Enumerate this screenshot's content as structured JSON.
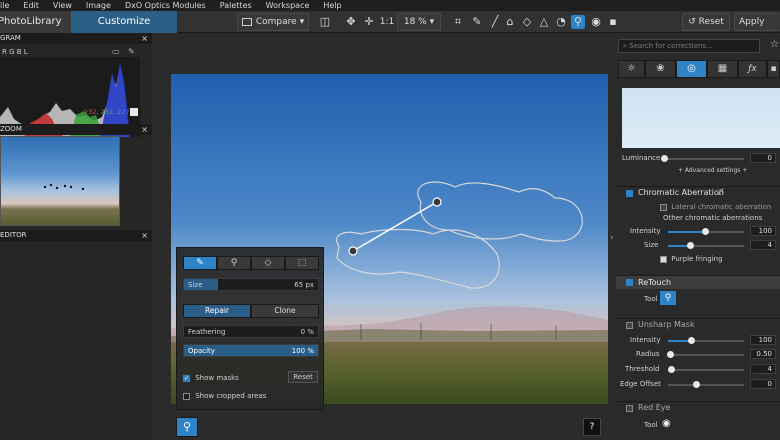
{
  "menu": [
    "File",
    "Edit",
    "View",
    "Image",
    "DxO Optics Modules",
    "Palettes",
    "Workspace",
    "Help"
  ],
  "tabs": {
    "library": "PhotoLibrary",
    "customize": "Customize"
  },
  "toolbar": {
    "compare": "Compare",
    "one_to_one": "1:1",
    "zoom": "18 %",
    "reset": "Reset",
    "apply": "Apply"
  },
  "left_panel": {
    "histogram_title": "GRAM",
    "histogram_channels": "R G B L",
    "histogram_readout": {
      "r": "232",
      "g": "232",
      "b": "227"
    },
    "zoom_title": "ZOOM",
    "editor_title": "EDITOR"
  },
  "palette": {
    "size_label": "Size",
    "size_value": "65 px",
    "size_fraction": 0.25,
    "repair": "Repair",
    "clone": "Clone",
    "feathering_label": "Feathering",
    "feathering_value": "0 %",
    "opacity_label": "Opacity",
    "opacity_value": "100 %",
    "show_masks": "Show masks",
    "reset": "Reset",
    "show_cropped": "Show cropped areas"
  },
  "bottom": {
    "help": "?"
  },
  "right_panel": {
    "search_placeholder": "Search for corrections...",
    "luminance_label": "Luminance",
    "luminance_value": "0",
    "advanced_settings": "+ Advanced settings +",
    "chromatic": {
      "title": "Chromatic Aberration",
      "lateral": "Lateral chromatic aberration",
      "other": "Other chromatic aberrations",
      "intensity_label": "Intensity",
      "intensity_value": "100",
      "size_label": "Size",
      "size_value": "4",
      "purple_fringing": "Purple fringing"
    },
    "retouch": {
      "title": "ReTouch",
      "tool_label": "Tool"
    },
    "unsharp": {
      "title": "Unsharp Mask",
      "intensity_label": "Intensity",
      "intensity_value": "100",
      "radius_label": "Radius",
      "radius_value": "0.50",
      "threshold_label": "Threshold",
      "threshold_value": "4",
      "edge_label": "Edge Offset",
      "edge_value": "0"
    },
    "red_eye": {
      "title": "Red Eye",
      "tool_label": "Tool"
    }
  },
  "colors": {
    "accent": "#2e83c7",
    "tab_active": "#2c5f86"
  }
}
